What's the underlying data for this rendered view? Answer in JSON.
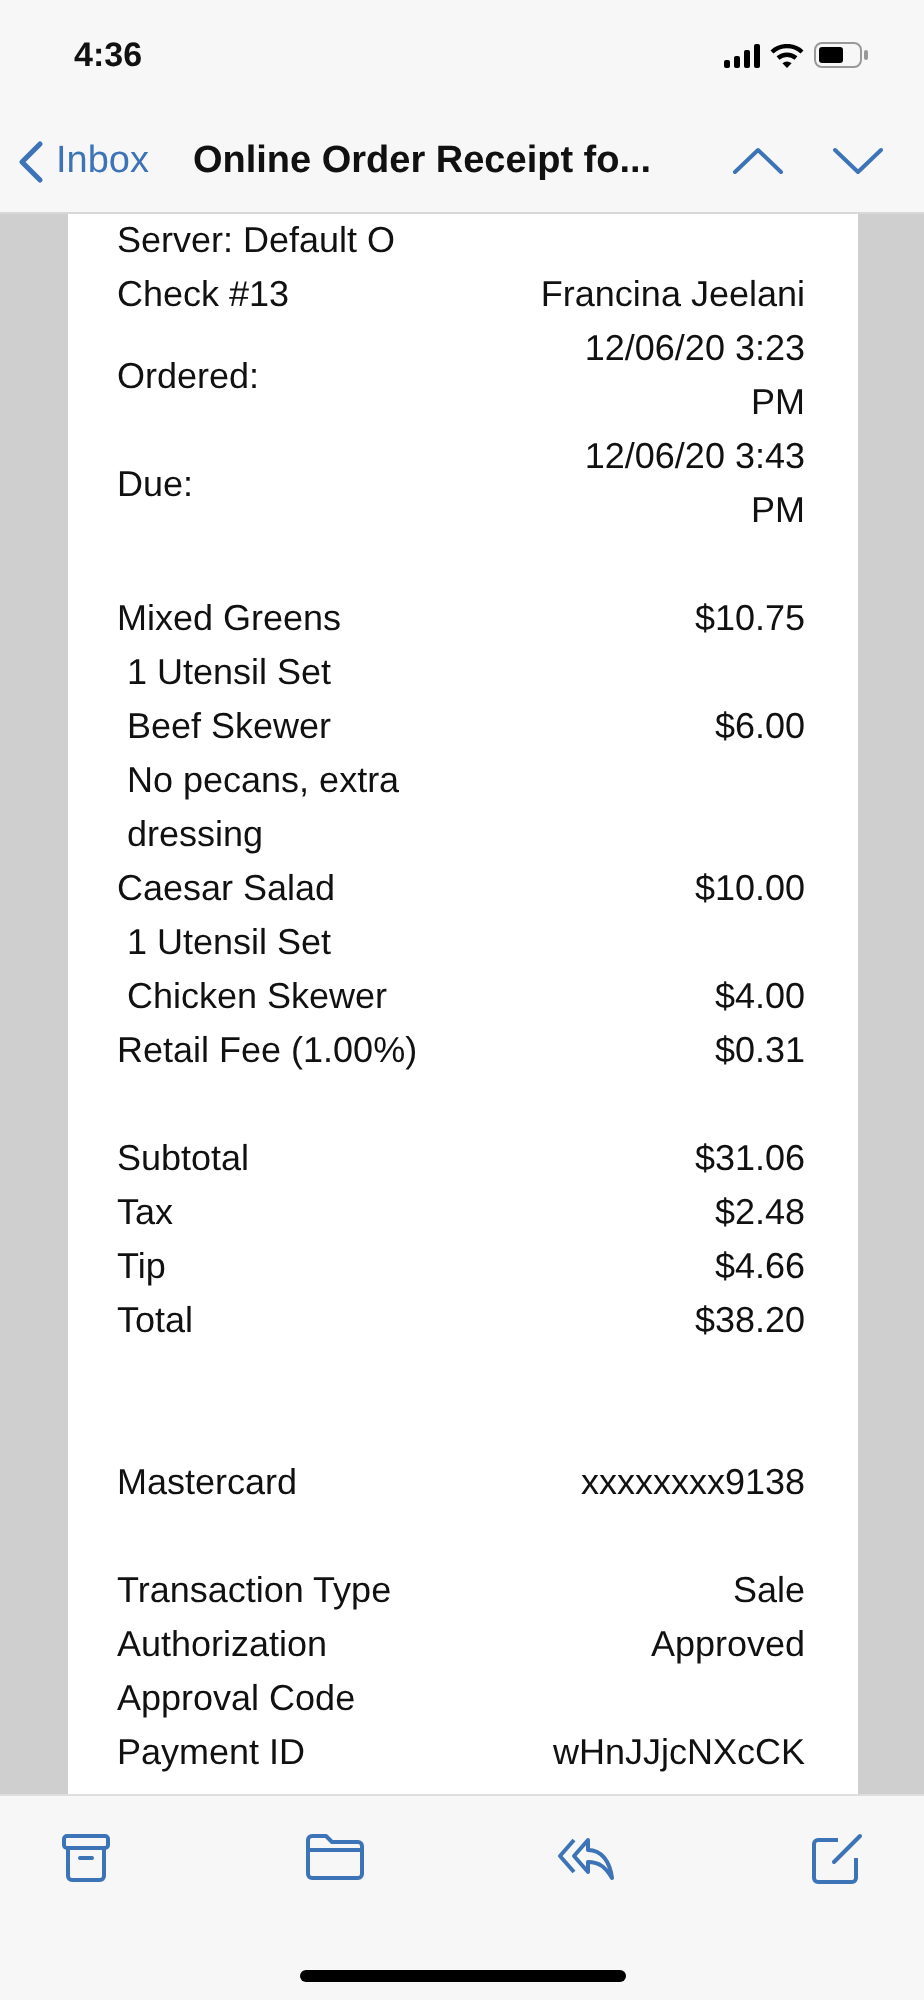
{
  "status_bar": {
    "time": "4:36"
  },
  "nav_bar": {
    "back_label": "Inbox",
    "title": "Online Order Receipt fo..."
  },
  "receipt": {
    "sections": [
      {
        "kind": "details",
        "rows": [
          {
            "kind": "line",
            "label": "Server: Default O"
          },
          {
            "kind": "line",
            "label": "Check #13",
            "value": "Francina Jeelani"
          },
          {
            "kind": "line",
            "label": "Ordered:",
            "value": "12/06/20 3:23 PM"
          },
          {
            "kind": "line",
            "label": "Due:",
            "value": "12/06/20 3:43 PM"
          }
        ]
      },
      {
        "kind": "items",
        "rows": [
          {
            "kind": "line",
            "label": "Mixed Greens",
            "value": "$10.75"
          },
          {
            "kind": "modifier",
            "label": "1 Utensil Set"
          },
          {
            "kind": "modifier",
            "label": "Beef Skewer",
            "value": "$6.00"
          },
          {
            "kind": "modifier",
            "label": "No pecans, extra dressing"
          },
          {
            "kind": "line",
            "label": "Caesar Salad",
            "value": "$10.00"
          },
          {
            "kind": "modifier",
            "label": "1 Utensil Set"
          },
          {
            "kind": "modifier",
            "label": "Chicken Skewer",
            "value": "$4.00"
          },
          {
            "kind": "line",
            "label": "Retail Fee (1.00%)",
            "value": "$0.31"
          }
        ]
      },
      {
        "kind": "totals",
        "rows": [
          {
            "kind": "line",
            "label": "Subtotal",
            "value": "$31.06"
          },
          {
            "kind": "line",
            "label": "Tax",
            "value": "$2.48"
          },
          {
            "kind": "line",
            "label": "Tip",
            "value": "$4.66"
          },
          {
            "kind": "line",
            "label": "Total",
            "value": "$38.20"
          }
        ]
      },
      {
        "kind": "payment",
        "rows": [
          {
            "kind": "line",
            "label": "Mastercard",
            "value": "xxxxxxxx9138"
          }
        ]
      },
      {
        "kind": "transaction",
        "rows": [
          {
            "kind": "line",
            "label": "Transaction Type",
            "value": "Sale"
          },
          {
            "kind": "line",
            "label": "Authorization",
            "value": "Approved"
          },
          {
            "kind": "line",
            "label": "Approval Code"
          },
          {
            "kind": "line",
            "label": "Payment ID",
            "value": "wHnJJjcNXcCK"
          }
        ]
      }
    ]
  }
}
